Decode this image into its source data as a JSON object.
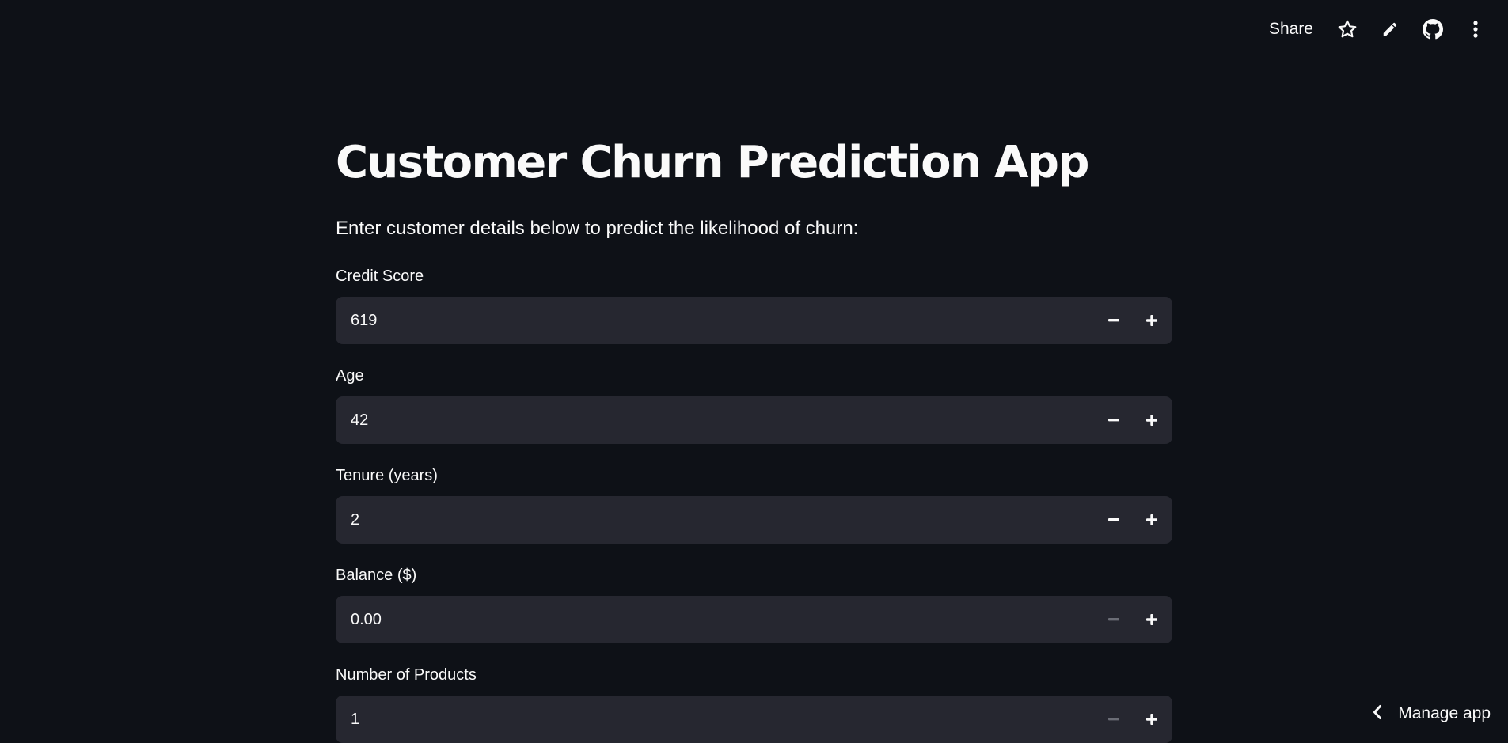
{
  "toolbar": {
    "share_label": "Share",
    "icons": [
      "star-icon",
      "pencil-icon",
      "github-icon",
      "more-vertical-icon"
    ]
  },
  "page": {
    "title": "Customer Churn Prediction App",
    "intro": "Enter customer details below to predict the likelihood of churn:"
  },
  "fields": [
    {
      "label": "Credit Score",
      "value": "619",
      "minus_disabled": false
    },
    {
      "label": "Age",
      "value": "42",
      "minus_disabled": false
    },
    {
      "label": "Tenure (years)",
      "value": "2",
      "minus_disabled": false
    },
    {
      "label": "Balance ($)",
      "value": "0.00",
      "minus_disabled": true
    },
    {
      "label": "Number of Products",
      "value": "1",
      "minus_disabled": true
    }
  ],
  "footer": {
    "manage_label": "Manage app"
  },
  "colors": {
    "background": "#0e1117",
    "input_background": "#262730",
    "text": "#fafafa",
    "disabled_icon": "#6b6d76"
  }
}
